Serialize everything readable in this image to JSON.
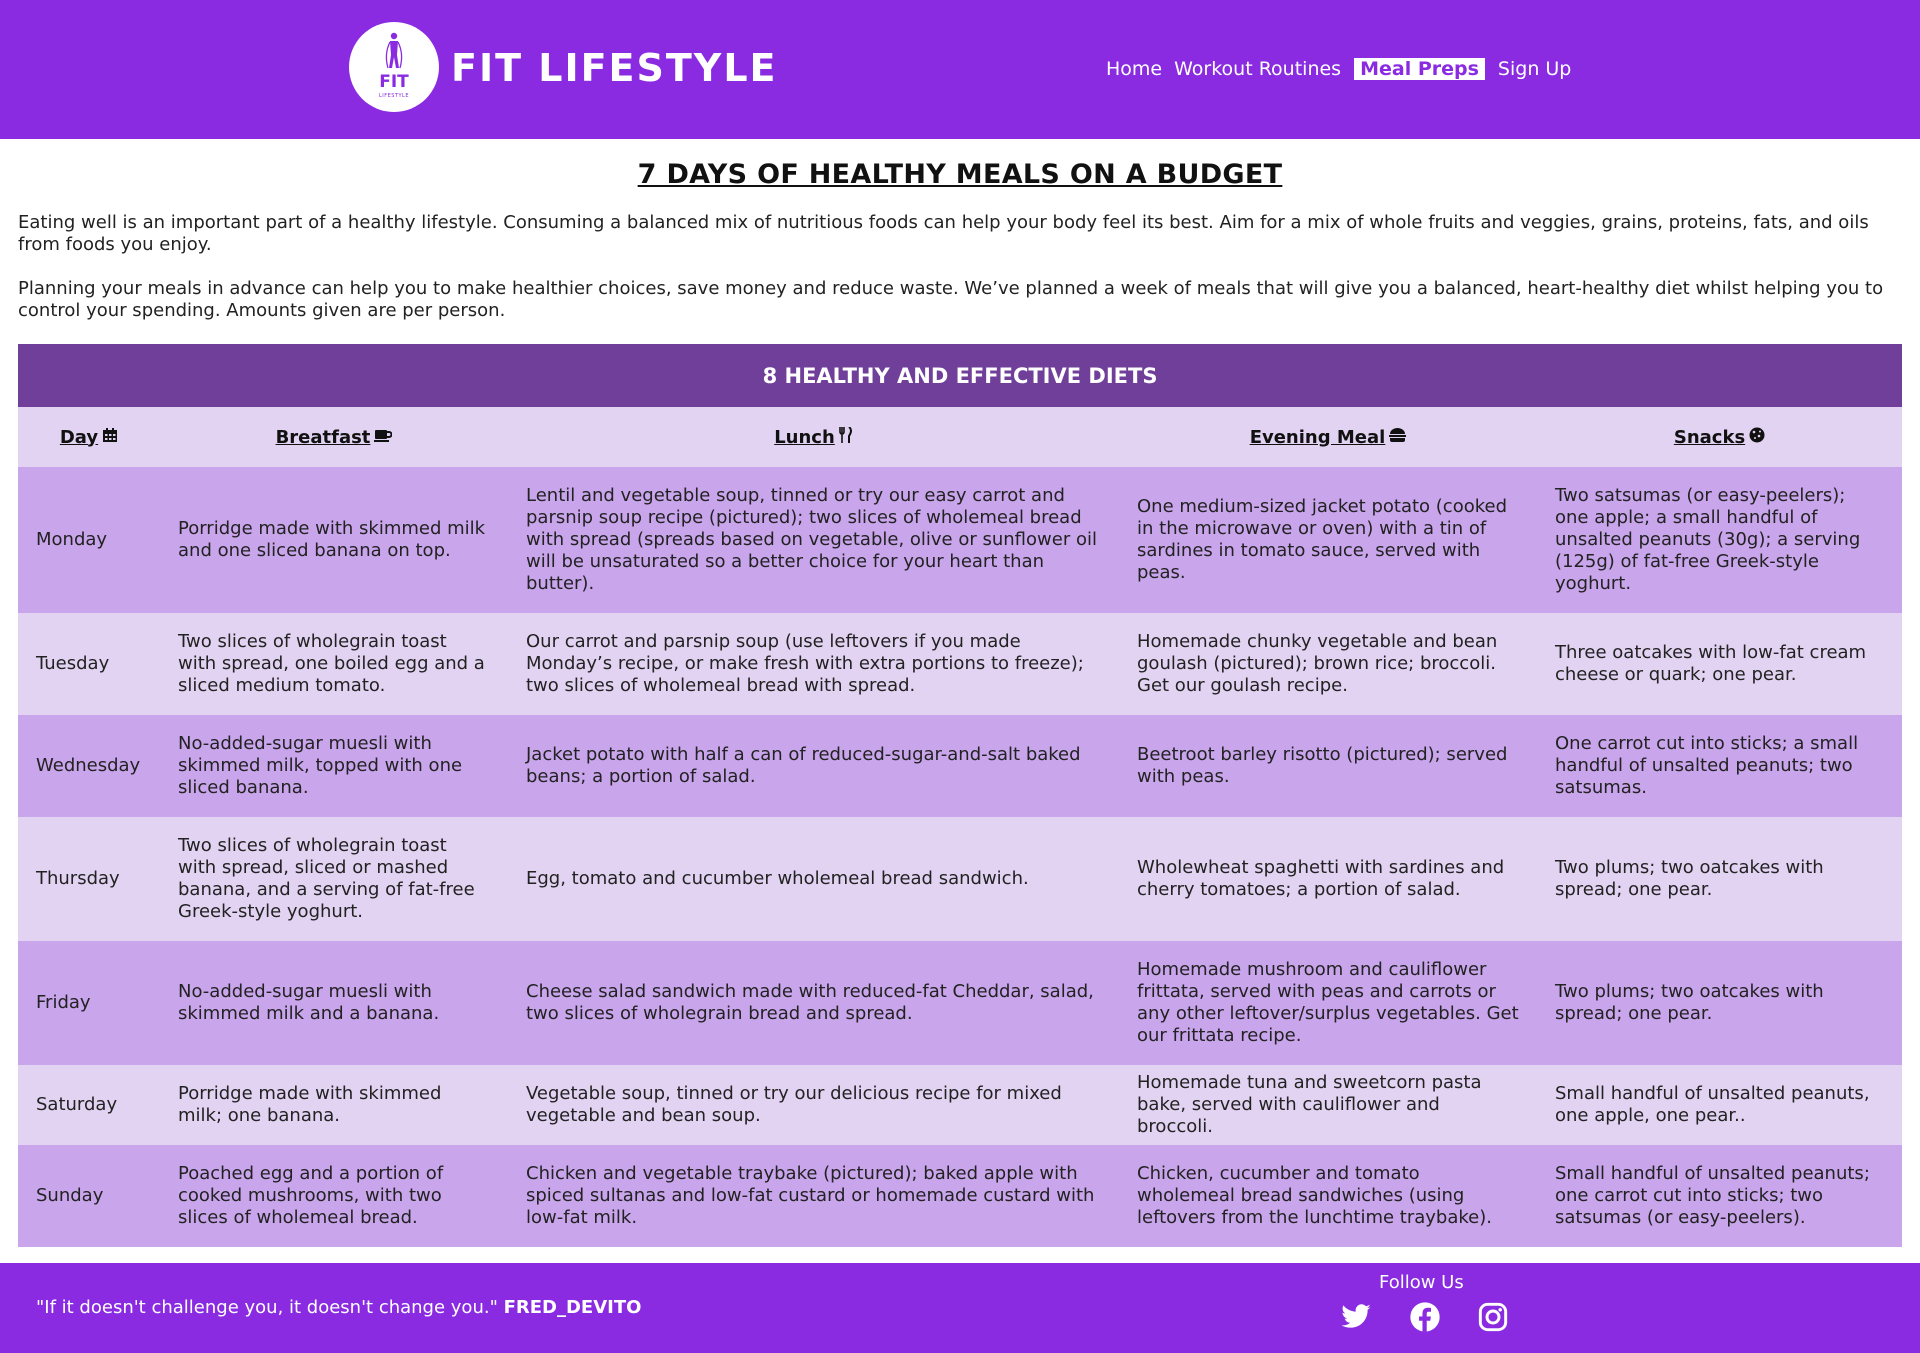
{
  "header": {
    "brand": "FIT LIFESTYLE",
    "logo": {
      "text": "FIT",
      "sub": "LIFESTYLE"
    },
    "nav": [
      {
        "label": "Home",
        "active": false
      },
      {
        "label": "Workout Routines",
        "active": false
      },
      {
        "label": "Meal Preps",
        "active": true
      },
      {
        "label": "Sign Up",
        "active": false
      }
    ]
  },
  "main": {
    "title": "7 DAYS OF HEALTHY MEALS ON A BUDGET",
    "intro1": "Eating well is an important part of a healthy lifestyle. Consuming a balanced mix of nutritious foods can help your body feel its best. Aim for a mix of whole fruits and veggies, grains, proteins, fats, and oils from foods you enjoy.",
    "intro2": "Planning your meals in advance can help you to make healthier choices, save money and reduce waste. We’ve planned a week of meals that will give you a balanced, heart-healthy diet whilst helping you to control your spending. Amounts given are per person."
  },
  "table": {
    "caption": "8 HEALTHY AND EFFECTIVE DIETS",
    "headers": [
      {
        "label": "Day",
        "icon": "calendar-icon"
      },
      {
        "label": "Breatfast",
        "icon": "coffee-icon"
      },
      {
        "label": "Lunch",
        "icon": "utensils-icon"
      },
      {
        "label": "Evening Meal",
        "icon": "hamburger-icon"
      },
      {
        "label": "Snacks",
        "icon": "cookie-icon"
      }
    ],
    "rows": [
      {
        "day": "Monday",
        "breakfast": "Porridge made with skimmed milk and one sliced banana on top.",
        "lunch": "Lentil and vegetable soup, tinned or try our easy carrot and parsnip soup recipe (pictured); two slices of wholemeal bread with spread (spreads based on vegetable, olive or sunflower oil will be unsaturated so a better choice for your heart than butter).",
        "evening": "One medium-sized jacket potato (cooked in the microwave or oven) with a tin of sardines in tomato sauce, served with peas.",
        "snacks": "Two satsumas (or easy-peelers); one apple; a small handful of unsalted peanuts (30g); a serving (125g) of fat-free Greek-style yoghurt."
      },
      {
        "day": "Tuesday",
        "breakfast": "Two slices of wholegrain toast with spread, one boiled egg and a sliced medium tomato.",
        "lunch": "Our carrot and parsnip soup (use leftovers if you made Monday’s recipe, or make fresh with extra portions to freeze); two slices of wholemeal bread with spread.",
        "evening": "Homemade chunky vegetable and bean goulash (pictured); brown rice; broccoli. Get our goulash recipe.",
        "snacks": "Three oatcakes with low-fat cream cheese or quark; one pear."
      },
      {
        "day": "Wednesday",
        "breakfast": "No-added-sugar muesli with skimmed milk, topped with one sliced banana.",
        "lunch": "Jacket potato with half a can of reduced-sugar-and-salt baked beans; a portion of salad.",
        "evening": "Beetroot barley risotto (pictured); served with peas.",
        "snacks": "One carrot cut into sticks; a small handful of unsalted peanuts; two satsumas."
      },
      {
        "day": "Thursday",
        "breakfast": "Two slices of wholegrain toast with spread, sliced or mashed banana, and a serving of fat-free Greek-style yoghurt.",
        "lunch": "Egg, tomato and cucumber wholemeal bread sandwich.",
        "evening": "Wholewheat spaghetti with sardines and cherry tomatoes; a portion of salad.",
        "snacks": "Two plums; two oatcakes with spread; one pear."
      },
      {
        "day": "Friday",
        "breakfast": "No-added-sugar muesli with skimmed milk and a banana.",
        "lunch": "Cheese salad sandwich made with reduced-fat Cheddar, salad, two slices of wholegrain bread and spread.",
        "evening": "Homemade mushroom and cauliflower frittata, served with peas and carrots or any other leftover/surplus vegetables. Get our frittata recipe.",
        "snacks": "Two plums; two oatcakes with spread; one pear."
      },
      {
        "day": "Saturday",
        "breakfast": "Porridge made with skimmed milk; one banana.",
        "lunch": "Vegetable soup, tinned or try our delicious recipe for mixed vegetable and bean soup.",
        "evening": "Homemade tuna and sweetcorn pasta bake, served with cauliflower and broccoli.",
        "snacks": "Small handful of unsalted peanuts, one apple, one pear.."
      },
      {
        "day": "Sunday",
        "breakfast": "Poached egg and a portion of cooked mushrooms, with two slices of wholemeal bread.",
        "lunch": "Chicken and vegetable traybake (pictured); baked apple with spiced sultanas and low-fat custard or homemade custard with low-fat milk.",
        "evening": "Chicken, cucumber and tomato wholemeal bread sandwiches (using leftovers from the lunchtime traybake).",
        "snacks": "Small handful of unsalted peanuts; one carrot cut into sticks; two satsumas (or easy-peelers)."
      }
    ]
  },
  "footer": {
    "quote": "\"If it doesn't challenge you, it doesn't change you.\"",
    "author": "FRED_DEVITO",
    "follow": "Follow Us",
    "social": [
      "twitter-icon",
      "facebook-icon",
      "instagram-icon"
    ]
  },
  "colors": {
    "primary": "#8a2be2",
    "caption": "#6f3f99",
    "row_dark": "#c9a5ec",
    "row_light": "#e2d3f2"
  }
}
